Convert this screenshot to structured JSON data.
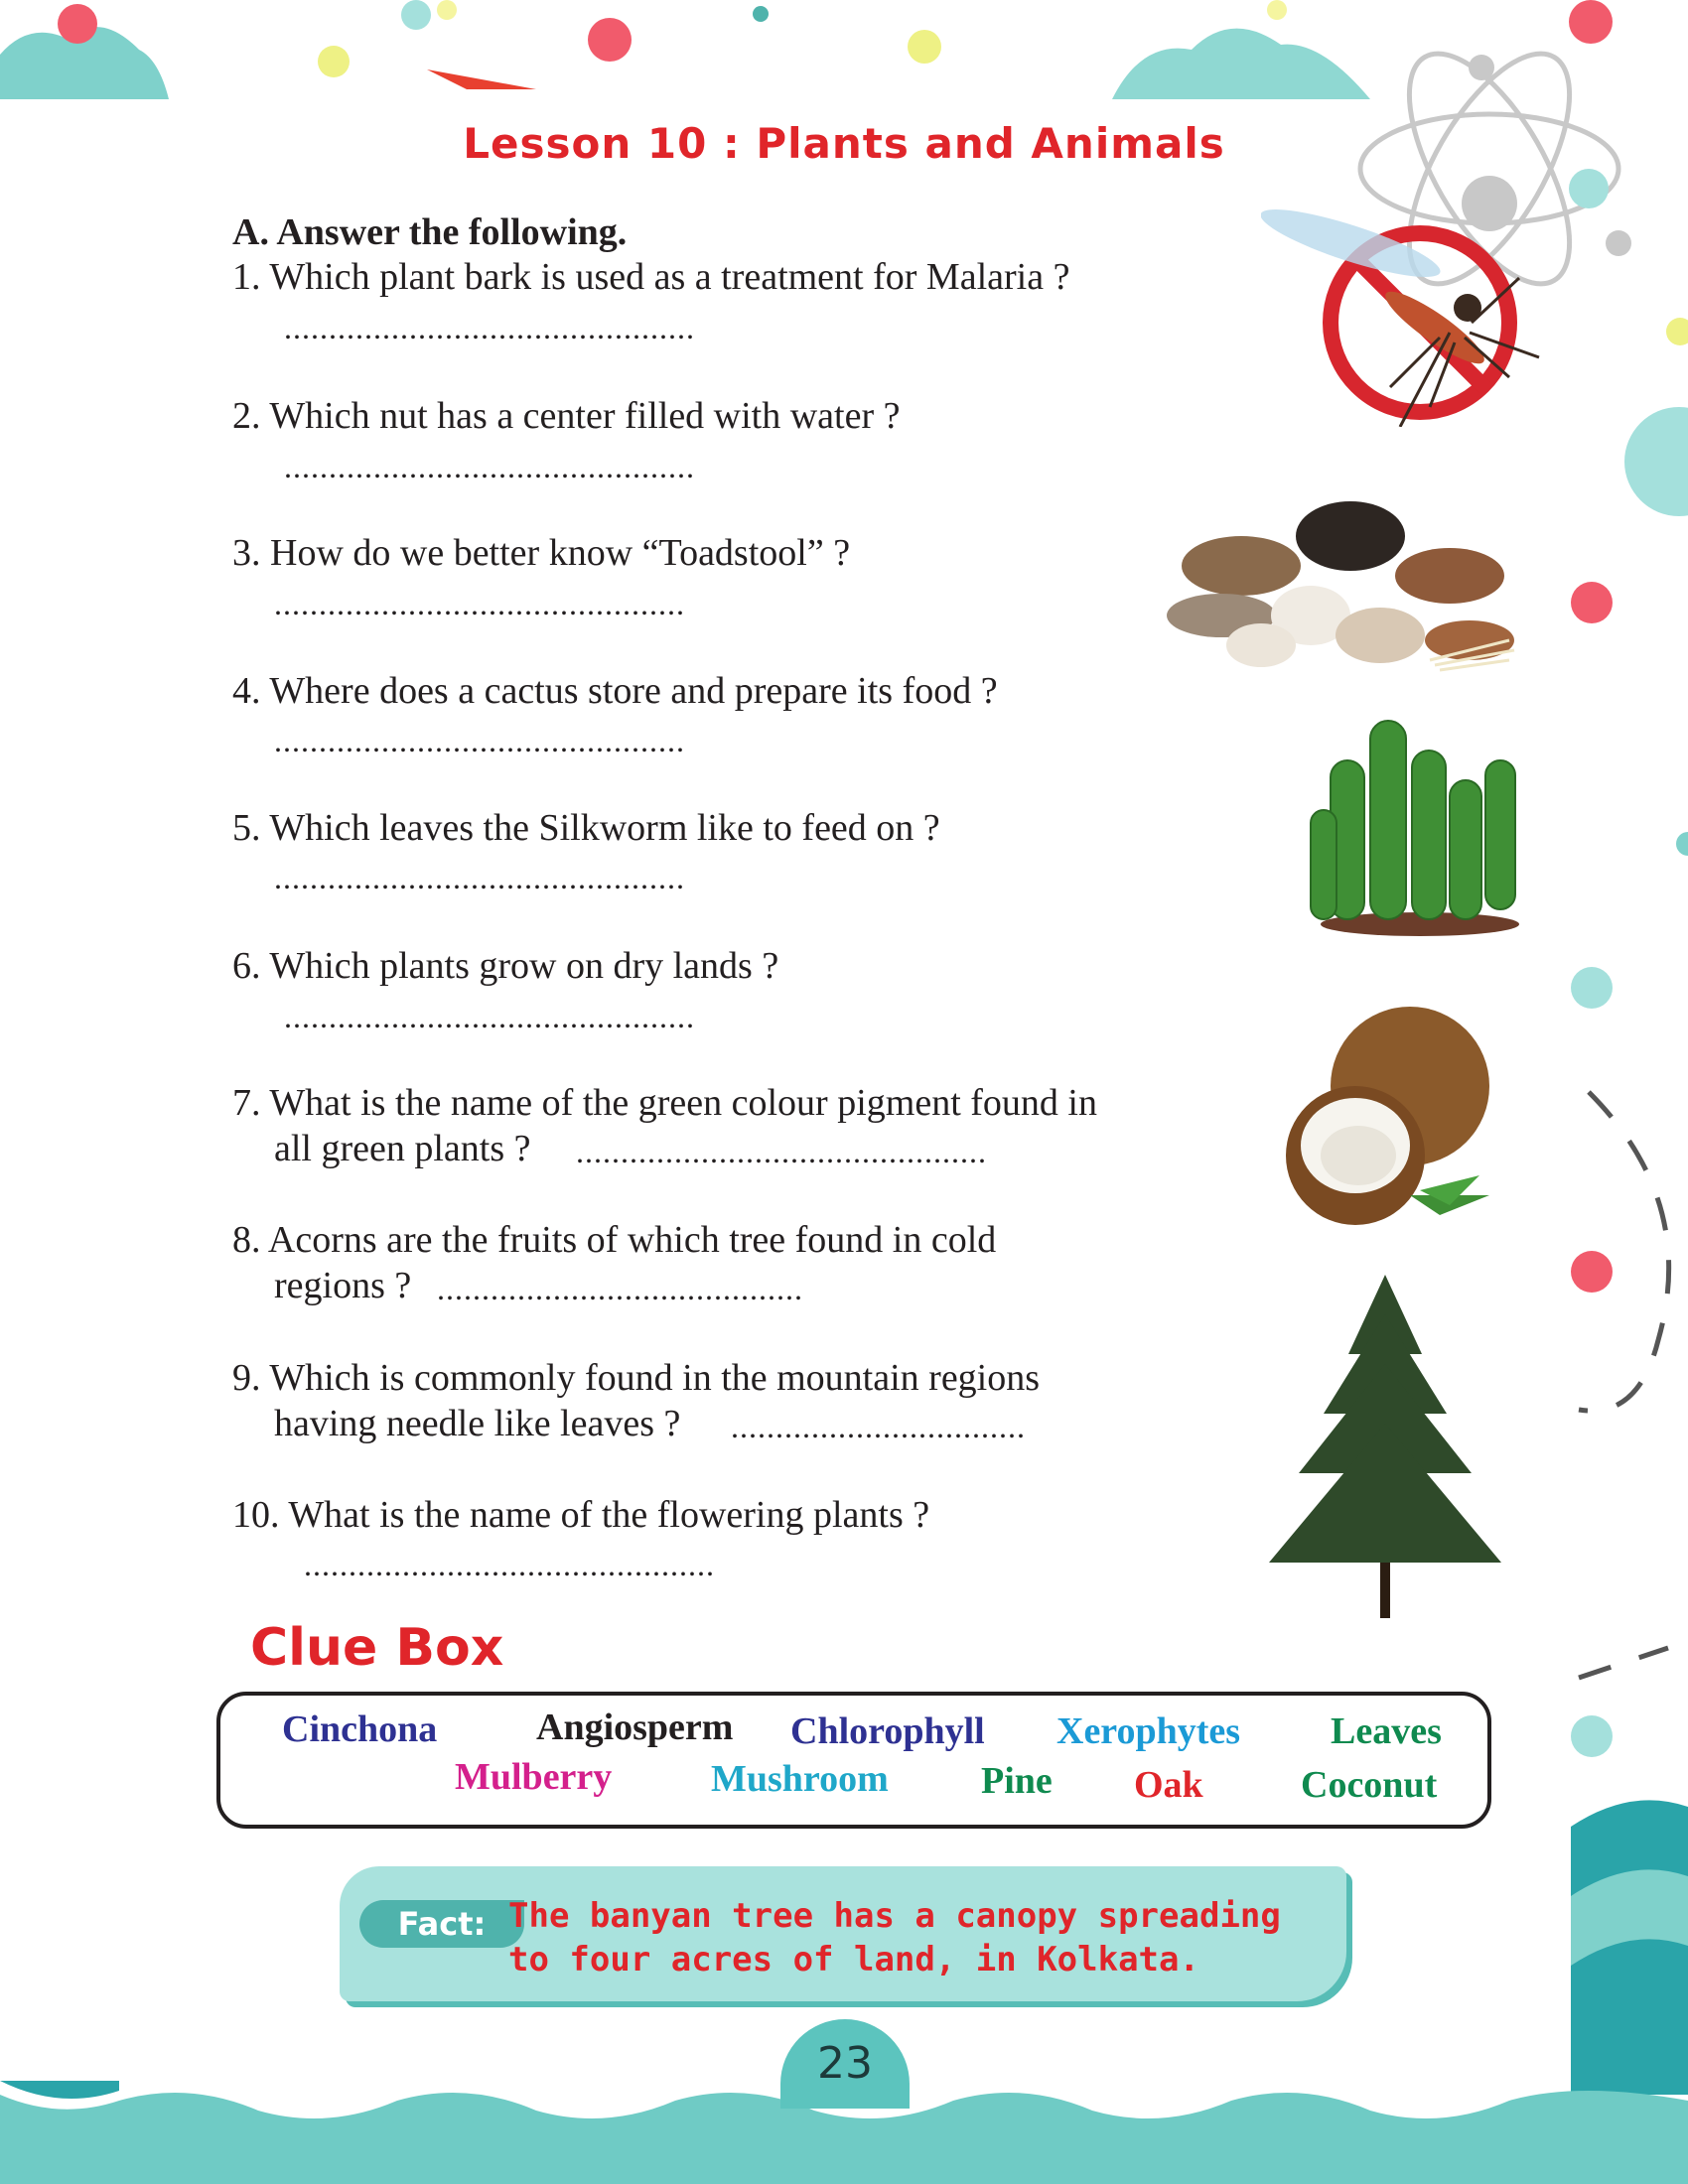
{
  "title": "Lesson 10 : Plants and Animals",
  "section_heading": "A. Answer the following.",
  "questions": [
    {
      "line1": "1.  Which plant bark is used as a treatment for Malaria ?",
      "answer": ".............................................."
    },
    {
      "line1": "2.  Which nut has a center filled with water ?",
      "answer": ".............................................."
    },
    {
      "line1": "3.  How do we better know “Toadstool” ?",
      "answer": ".............................................."
    },
    {
      "line1": "4. Where does a cactus store and  prepare its food ?",
      "answer": ".............................................."
    },
    {
      "line1": "5. Which leaves the Silkworm like to feed on ?",
      "answer": ".............................................."
    },
    {
      "line1": "6. Which plants grow on dry lands ?",
      "answer": ".............................................."
    },
    {
      "line1": "7. What is the name of the green colour pigment found in",
      "line2": "all green plants ?",
      "answer": ".............................................."
    },
    {
      "line1": "8. Acorns are the fruits of which tree found in cold",
      "line2": "regions ?",
      "answer": "........................................."
    },
    {
      "line1": "9. Which is commonly found in the mountain regions",
      "line2": "having needle like leaves ?",
      "answer": "................................."
    },
    {
      "line1": "10. What is the name of the flowering plants ?",
      "answer": ".............................................."
    }
  ],
  "clue_box": {
    "heading": "Clue Box",
    "words": [
      {
        "text": "Cinchona",
        "color": "#2e3192"
      },
      {
        "text": "Angiosperm",
        "color": "#231f20"
      },
      {
        "text": "Chlorophyll",
        "color": "#2e3192"
      },
      {
        "text": "Xerophytes",
        "color": "#1b9ad6"
      },
      {
        "text": "Leaves",
        "color": "#0f8a4f"
      },
      {
        "text": "Mulberry",
        "color": "#d4208c"
      },
      {
        "text": "Mushroom",
        "color": "#1fa7c9"
      },
      {
        "text": "Pine",
        "color": "#0f8a4f"
      },
      {
        "text": "Oak",
        "color": "#e0252a"
      },
      {
        "text": "Coconut",
        "color": "#0f8a4f"
      }
    ]
  },
  "fact": {
    "label": "Fact:",
    "line1": "The banyan tree has a canopy spreading",
    "line2": "to four acres of land, in Kolkata."
  },
  "page_number": "23",
  "colors": {
    "accent_red": "#e0252a",
    "teal": "#5cc4be",
    "teal_light": "#a9e2dd"
  },
  "illustrations": [
    "no-mosquito-icon",
    "mushrooms-image",
    "cactus-image",
    "coconut-image",
    "pine-tree-image",
    "atom-icon"
  ]
}
